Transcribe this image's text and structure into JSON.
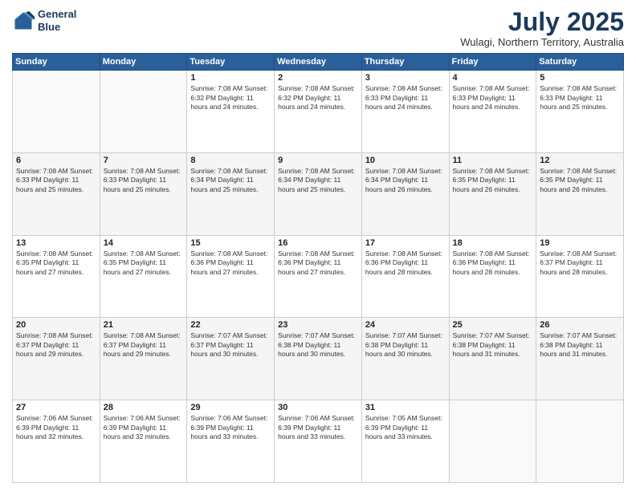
{
  "header": {
    "logo_line1": "General",
    "logo_line2": "Blue",
    "month": "July 2025",
    "location": "Wulagi, Northern Territory, Australia"
  },
  "weekdays": [
    "Sunday",
    "Monday",
    "Tuesday",
    "Wednesday",
    "Thursday",
    "Friday",
    "Saturday"
  ],
  "weeks": [
    [
      {
        "day": "",
        "info": ""
      },
      {
        "day": "",
        "info": ""
      },
      {
        "day": "1",
        "info": "Sunrise: 7:08 AM\nSunset: 6:32 PM\nDaylight: 11 hours and 24 minutes."
      },
      {
        "day": "2",
        "info": "Sunrise: 7:08 AM\nSunset: 6:32 PM\nDaylight: 11 hours and 24 minutes."
      },
      {
        "day": "3",
        "info": "Sunrise: 7:08 AM\nSunset: 6:33 PM\nDaylight: 11 hours and 24 minutes."
      },
      {
        "day": "4",
        "info": "Sunrise: 7:08 AM\nSunset: 6:33 PM\nDaylight: 11 hours and 24 minutes."
      },
      {
        "day": "5",
        "info": "Sunrise: 7:08 AM\nSunset: 6:33 PM\nDaylight: 11 hours and 25 minutes."
      }
    ],
    [
      {
        "day": "6",
        "info": "Sunrise: 7:08 AM\nSunset: 6:33 PM\nDaylight: 11 hours and 25 minutes."
      },
      {
        "day": "7",
        "info": "Sunrise: 7:08 AM\nSunset: 6:33 PM\nDaylight: 11 hours and 25 minutes."
      },
      {
        "day": "8",
        "info": "Sunrise: 7:08 AM\nSunset: 6:34 PM\nDaylight: 11 hours and 25 minutes."
      },
      {
        "day": "9",
        "info": "Sunrise: 7:08 AM\nSunset: 6:34 PM\nDaylight: 11 hours and 25 minutes."
      },
      {
        "day": "10",
        "info": "Sunrise: 7:08 AM\nSunset: 6:34 PM\nDaylight: 11 hours and 26 minutes."
      },
      {
        "day": "11",
        "info": "Sunrise: 7:08 AM\nSunset: 6:35 PM\nDaylight: 11 hours and 26 minutes."
      },
      {
        "day": "12",
        "info": "Sunrise: 7:08 AM\nSunset: 6:35 PM\nDaylight: 11 hours and 26 minutes."
      }
    ],
    [
      {
        "day": "13",
        "info": "Sunrise: 7:08 AM\nSunset: 6:35 PM\nDaylight: 11 hours and 27 minutes."
      },
      {
        "day": "14",
        "info": "Sunrise: 7:08 AM\nSunset: 6:35 PM\nDaylight: 11 hours and 27 minutes."
      },
      {
        "day": "15",
        "info": "Sunrise: 7:08 AM\nSunset: 6:36 PM\nDaylight: 11 hours and 27 minutes."
      },
      {
        "day": "16",
        "info": "Sunrise: 7:08 AM\nSunset: 6:36 PM\nDaylight: 11 hours and 27 minutes."
      },
      {
        "day": "17",
        "info": "Sunrise: 7:08 AM\nSunset: 6:36 PM\nDaylight: 11 hours and 28 minutes."
      },
      {
        "day": "18",
        "info": "Sunrise: 7:08 AM\nSunset: 6:36 PM\nDaylight: 11 hours and 28 minutes."
      },
      {
        "day": "19",
        "info": "Sunrise: 7:08 AM\nSunset: 6:37 PM\nDaylight: 11 hours and 28 minutes."
      }
    ],
    [
      {
        "day": "20",
        "info": "Sunrise: 7:08 AM\nSunset: 6:37 PM\nDaylight: 11 hours and 29 minutes."
      },
      {
        "day": "21",
        "info": "Sunrise: 7:08 AM\nSunset: 6:37 PM\nDaylight: 11 hours and 29 minutes."
      },
      {
        "day": "22",
        "info": "Sunrise: 7:07 AM\nSunset: 6:37 PM\nDaylight: 11 hours and 30 minutes."
      },
      {
        "day": "23",
        "info": "Sunrise: 7:07 AM\nSunset: 6:38 PM\nDaylight: 11 hours and 30 minutes."
      },
      {
        "day": "24",
        "info": "Sunrise: 7:07 AM\nSunset: 6:38 PM\nDaylight: 11 hours and 30 minutes."
      },
      {
        "day": "25",
        "info": "Sunrise: 7:07 AM\nSunset: 6:38 PM\nDaylight: 11 hours and 31 minutes."
      },
      {
        "day": "26",
        "info": "Sunrise: 7:07 AM\nSunset: 6:38 PM\nDaylight: 11 hours and 31 minutes."
      }
    ],
    [
      {
        "day": "27",
        "info": "Sunrise: 7:06 AM\nSunset: 6:39 PM\nDaylight: 11 hours and 32 minutes."
      },
      {
        "day": "28",
        "info": "Sunrise: 7:06 AM\nSunset: 6:39 PM\nDaylight: 11 hours and 32 minutes."
      },
      {
        "day": "29",
        "info": "Sunrise: 7:06 AM\nSunset: 6:39 PM\nDaylight: 11 hours and 33 minutes."
      },
      {
        "day": "30",
        "info": "Sunrise: 7:06 AM\nSunset: 6:39 PM\nDaylight: 11 hours and 33 minutes."
      },
      {
        "day": "31",
        "info": "Sunrise: 7:05 AM\nSunset: 6:39 PM\nDaylight: 11 hours and 33 minutes."
      },
      {
        "day": "",
        "info": ""
      },
      {
        "day": "",
        "info": ""
      }
    ]
  ]
}
